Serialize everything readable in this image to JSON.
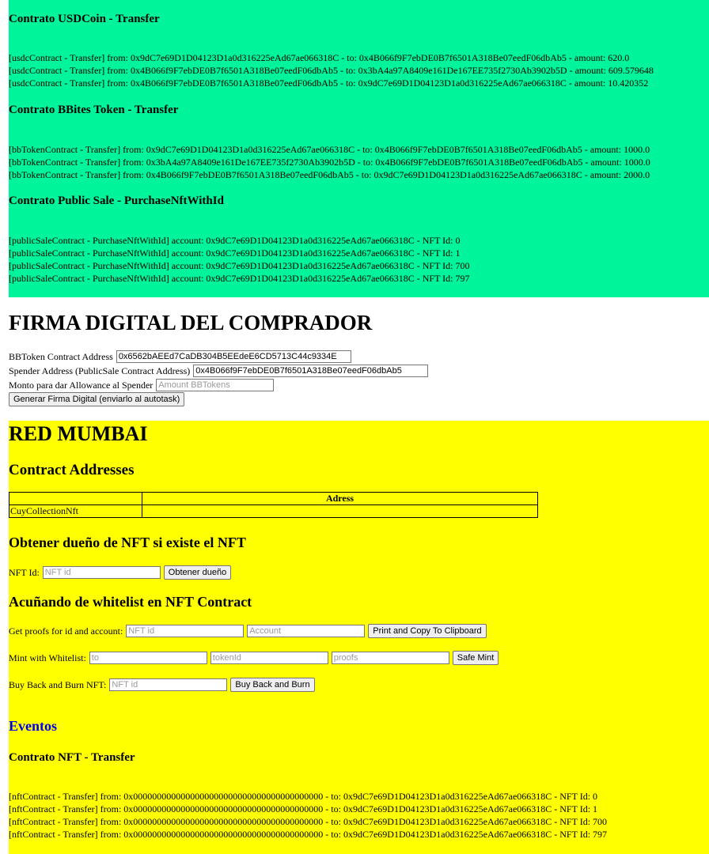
{
  "usdc": {
    "title": "Contrato USDCoin - Transfer",
    "lines": [
      "[usdcContract - Transfer] from: 0x9dC7e69D1D04123D1a0d316225eAd67ae066318C - to: 0x4B066f9F7ebDE0B7f6501A318Be07eedF06dbAb5 - amount: 620.0",
      "[usdcContract - Transfer] from: 0x4B066f9F7ebDE0B7f6501A318Be07eedF06dbAb5 - to: 0x3bA4a97A8409e161De167EE735f2730Ab3902b5D - amount: 609.579648",
      "[usdcContract - Transfer] from: 0x4B066f9F7ebDE0B7f6501A318Be07eedF06dbAb5 - to: 0x9dC7e69D1D04123D1a0d316225eAd67ae066318C - amount: 10.420352"
    ]
  },
  "bbites": {
    "title": "Contrato BBites Token - Transfer",
    "lines": [
      "[bbTokenContract - Transfer] from: 0x9dC7e69D1D04123D1a0d316225eAd67ae066318C - to: 0x4B066f9F7ebDE0B7f6501A318Be07eedF06dbAb5 - amount: 1000.0",
      "[bbTokenContract - Transfer] from: 0x3bA4a97A8409e161De167EE735f2730Ab3902b5D - to: 0x4B066f9F7ebDE0B7f6501A318Be07eedF06dbAb5 - amount: 1000.0",
      "[bbTokenContract - Transfer] from: 0x4B066f9F7ebDE0B7f6501A318Be07eedF06dbAb5 - to: 0x9dC7e69D1D04123D1a0d316225eAd67ae066318C - amount: 2000.0"
    ]
  },
  "publicSale": {
    "title": "Contrato Public Sale - PurchaseNftWithId",
    "lines": [
      "[publicSaleContract - PurchaseNftWithId] account: 0x9dC7e69D1D04123D1a0d316225eAd67ae066318C - NFT Id: 0",
      "[publicSaleContract - PurchaseNftWithId] account: 0x9dC7e69D1D04123D1a0d316225eAd67ae066318C - NFT Id: 1",
      "[publicSaleContract - PurchaseNftWithId] account: 0x9dC7e69D1D04123D1a0d316225eAd67ae066318C - NFT Id: 700",
      "[publicSaleContract - PurchaseNftWithId] account: 0x9dC7e69D1D04123D1a0d316225eAd67ae066318C - NFT Id: 797"
    ]
  },
  "firma": {
    "title": "FIRMA DIGITAL DEL COMPRADOR",
    "bbtoken_label": "BBToken Contract Address",
    "bbtoken_value": "0x6562bAEEd7CaDB304B5EEdeE6CD5713C44c9334E",
    "spender_label": "Spender Address (PublicSale Contract Address)",
    "spender_value": "0x4B066f9F7ebDE0B7f6501A318Be07eedF06dbAb5",
    "monto_label": "Monto para dar Allowance al Spender",
    "monto_placeholder": "Amount BBTokens",
    "button": "Generar Firma Digital (enviarlo al autotask)"
  },
  "mumbai": {
    "title": "RED MUMBAI",
    "addresses_title": "Contract Addresses",
    "table_header": [
      "",
      "Adress"
    ],
    "table_rows": [
      [
        "CuyCollectionNft",
        ""
      ]
    ],
    "owner_title": "Obtener dueño de NFT si existe el NFT",
    "owner_label": "NFT Id:",
    "owner_placeholder": "NFT id",
    "owner_button": "Obtener dueño",
    "whitelist_title": "Acuñando de whitelist en NFT Contract",
    "proofs_label": "Get proofs for id and account:",
    "proofs_ph_id": "NFT id",
    "proofs_ph_account": "Account",
    "proofs_button": "Print and Copy To Clipboard",
    "mint_label": "Mint with Whitelist:",
    "mint_ph_to": "to",
    "mint_ph_tokenid": "tokenId",
    "mint_ph_proofs": "proofs",
    "mint_button": "Safe Mint",
    "burn_label": "Buy Back and Burn NFT:",
    "burn_placeholder": "NFT id",
    "burn_button": "Buy Back and Burn",
    "events_title": "Eventos",
    "nft_title": "Contrato NFT - Transfer",
    "nft_lines": [
      "[nftContract - Transfer] from: 0x0000000000000000000000000000000000000000 - to: 0x9dC7e69D1D04123D1a0d316225eAd67ae066318C - NFT Id: 0",
      "[nftContract - Transfer] from: 0x0000000000000000000000000000000000000000 - to: 0x9dC7e69D1D04123D1a0d316225eAd67ae066318C - NFT Id: 1",
      "[nftContract - Transfer] from: 0x0000000000000000000000000000000000000000 - to: 0x9dC7e69D1D04123D1a0d316225eAd67ae066318C - NFT Id: 700",
      "[nftContract - Transfer] from: 0x0000000000000000000000000000000000000000 - to: 0x9dC7e69D1D04123D1a0d316225eAd67ae066318C - NFT Id: 797"
    ]
  },
  "colors": {
    "events_section": "#00f59a",
    "mumbai_section": "#ffff00",
    "events_heading": "#0000ee"
  }
}
